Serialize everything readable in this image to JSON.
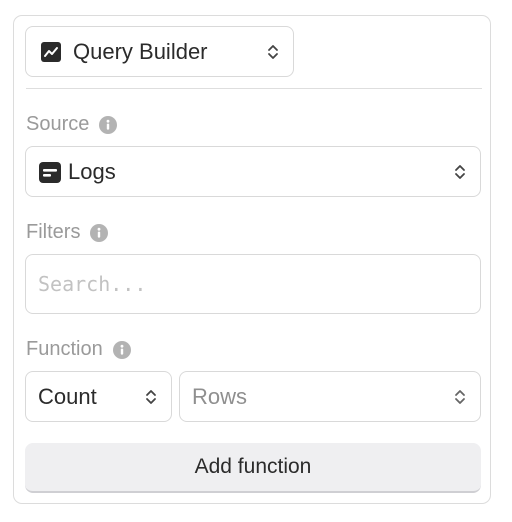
{
  "builder": {
    "mode_label": "Query Builder",
    "icon": "chart-line-icon"
  },
  "source": {
    "label": "Source",
    "value": "Logs",
    "icon": "logs-icon"
  },
  "filters": {
    "label": "Filters",
    "placeholder": "Search..."
  },
  "function": {
    "label": "Function",
    "aggregate": "Count",
    "target": "Rows",
    "add_button": "Add function"
  }
}
